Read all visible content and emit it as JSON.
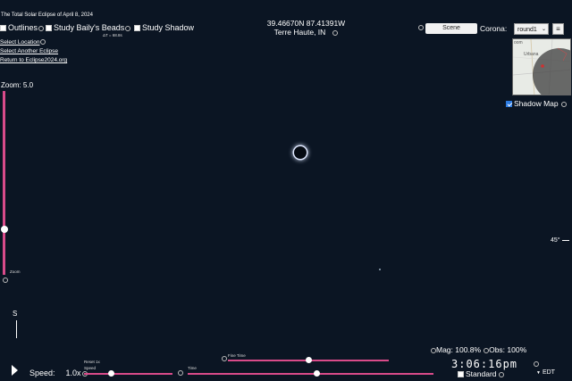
{
  "title": "The Total Solar Eclipse of April 8, 2024",
  "options": {
    "outlines": "Outlines",
    "bailys_beads": "Study Baily's Beads",
    "bailys_sub": "ΔT = 68.8s",
    "study_shadow": "Study Shadow"
  },
  "links": {
    "select_location": "Select Location",
    "select_another": "Select Another Eclipse",
    "return": "Return to Eclipse2024.org"
  },
  "location": {
    "coords": "39.46670N 87.41391W",
    "city": "Terre Haute, IN"
  },
  "zoom": {
    "label": "Zoom: 5.0",
    "caption": "Zoom"
  },
  "view": {
    "scene_button": "Scene",
    "corona_label": "Corona:",
    "corona_value": "round1",
    "menu_icon": "≡",
    "shadow_map_label": "Shadow Map",
    "map_town": "Urbana",
    "map_town2": "oom"
  },
  "horizon_label": "45°",
  "compass_label": "S",
  "stats": {
    "mag": "Mag: 100.8%",
    "obs": "Obs: 100%"
  },
  "controls": {
    "speed_label": "Speed:",
    "speed_value": "1.0x",
    "reset_label": "Reset 1x",
    "speed_caption": "Speed",
    "time_caption": "Time",
    "fine_time_caption": "Fine Time",
    "clock": "3:06:16pm",
    "standard_label": "Standard",
    "timezone": "EDT"
  },
  "colors": {
    "background": "#0b1523",
    "slider": "#d94b8a"
  }
}
